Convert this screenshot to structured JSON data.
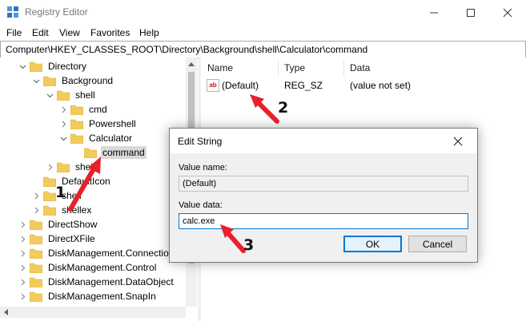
{
  "window": {
    "title": "Registry Editor"
  },
  "menu": [
    "File",
    "Edit",
    "View",
    "Favorites",
    "Help"
  ],
  "address": "Computer\\HKEY_CLASSES_ROOT\\Directory\\Background\\shell\\Calculator\\command",
  "tree": [
    {
      "label": "Directory",
      "expand": "expanded",
      "selected": false
    },
    {
      "label": "Background",
      "expand": "expanded",
      "selected": false
    },
    {
      "label": "shell",
      "expand": "expanded",
      "selected": false
    },
    {
      "label": "cmd",
      "expand": "collapsed",
      "selected": false
    },
    {
      "label": "Powershell",
      "expand": "collapsed",
      "selected": false
    },
    {
      "label": "Calculator",
      "expand": "expanded",
      "selected": false
    },
    {
      "label": "command",
      "expand": "none",
      "selected": true
    },
    {
      "label": "shell",
      "expand": "collapsed",
      "selected": false
    },
    {
      "label": "DefaultIcon",
      "expand": "none",
      "selected": false
    },
    {
      "label": "shell",
      "expand": "collapsed",
      "selected": false
    },
    {
      "label": "shellex",
      "expand": "collapsed",
      "selected": false
    },
    {
      "label": "DirectShow",
      "expand": "collapsed",
      "selected": false
    },
    {
      "label": "DirectXFile",
      "expand": "collapsed",
      "selected": false
    },
    {
      "label": "DiskManagement.Connection",
      "expand": "collapsed",
      "selected": false
    },
    {
      "label": "DiskManagement.Control",
      "expand": "collapsed",
      "selected": false
    },
    {
      "label": "DiskManagement.DataObject",
      "expand": "collapsed",
      "selected": false
    },
    {
      "label": "DiskManagement.SnapIn",
      "expand": "collapsed",
      "selected": false
    }
  ],
  "list": {
    "headers": [
      "Name",
      "Type",
      "Data"
    ],
    "rows": [
      {
        "name": "(Default)",
        "type": "REG_SZ",
        "data": "(value not set)"
      }
    ]
  },
  "dialog": {
    "title": "Edit String",
    "value_name_label": "Value name:",
    "value_name": "(Default)",
    "value_data_label": "Value data:",
    "value_data": "calc.exe",
    "ok_label": "OK",
    "cancel_label": "Cancel"
  },
  "annotations": {
    "one": "1",
    "two": "2",
    "three": "3",
    "color": "#e8202a"
  },
  "colors": {
    "folder": "#f2cb5c",
    "accent": "#0078d7",
    "selection": "#d9d9d9"
  }
}
